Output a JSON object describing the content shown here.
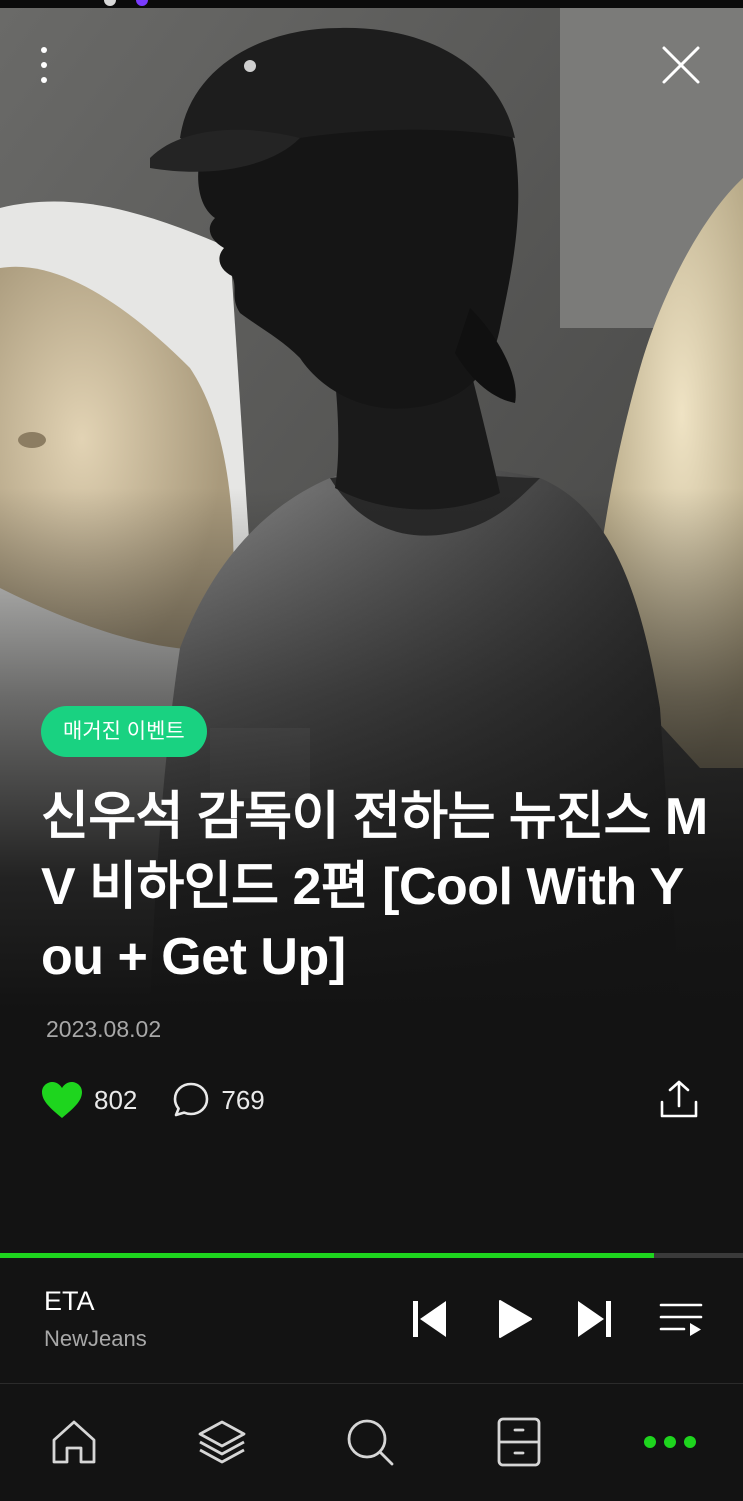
{
  "article": {
    "category": "매거진 이벤트",
    "title": "신우석 감독이 전하는 뉴진스 MV 비하인드 2편 [Cool With You + Get Up]",
    "date": "2023.08.02",
    "likes": "802",
    "comments": "769"
  },
  "player": {
    "song_title": "ETA",
    "artist": "NewJeans",
    "progress": 0.88
  },
  "icons": {
    "more": "more-vertical-icon",
    "close": "close-icon",
    "like": "heart-icon",
    "comment": "comment-icon",
    "share": "share-icon",
    "prev": "skip-previous-icon",
    "play": "play-icon",
    "next": "skip-next-icon",
    "playlist": "playlist-icon",
    "home": "home-icon",
    "stack": "layers-icon",
    "search": "search-icon",
    "library": "drawer-icon",
    "menu": "more-horizontal-icon"
  },
  "colors": {
    "accent": "#1ed51e",
    "category_pill": "#19d281",
    "background": "#131313",
    "secondary_text": "#a8a8a8"
  }
}
